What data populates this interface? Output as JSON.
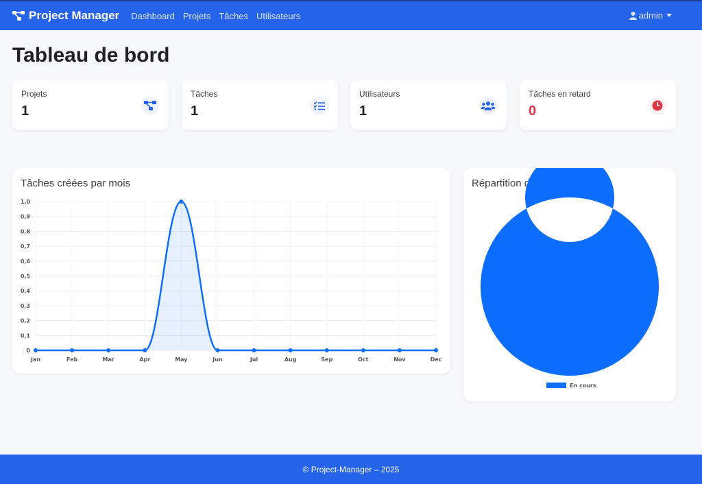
{
  "navbar": {
    "brand": "Project Manager",
    "links": [
      "Dashboard",
      "Projets",
      "Tâches",
      "Utilisateurs"
    ],
    "user": "admin"
  },
  "page": {
    "title": "Tableau de bord"
  },
  "stats": [
    {
      "label": "Projets",
      "value": "1",
      "icon": "project-diagram-icon"
    },
    {
      "label": "Tâches",
      "value": "1",
      "icon": "tasks-icon"
    },
    {
      "label": "Utilisateurs",
      "value": "1",
      "icon": "users-icon"
    },
    {
      "label": "Tâches en retard",
      "value": "0",
      "icon": "clock-icon"
    }
  ],
  "colors": {
    "primary": "#2563eb",
    "danger": "#dc3545",
    "chart_blue": "#0d6efd"
  },
  "chart_data": [
    {
      "type": "area",
      "title": "Tâches créées par mois",
      "categories": [
        "Jan",
        "Feb",
        "Mar",
        "Apr",
        "May",
        "Jun",
        "Jul",
        "Aug",
        "Sep",
        "Oct",
        "Nov",
        "Dec"
      ],
      "values": [
        0,
        0,
        0,
        0,
        1,
        0,
        0,
        0,
        0,
        0,
        0,
        0
      ],
      "ylim": [
        0,
        1
      ],
      "yticks": [
        "0",
        "0,1",
        "0,2",
        "0,3",
        "0,4",
        "0,5",
        "0,6",
        "0,7",
        "0,8",
        "0,9",
        "1,0"
      ],
      "grid": true
    },
    {
      "type": "pie",
      "title": "Répartition des statuts",
      "labels": [
        "En cours"
      ],
      "values": [
        1
      ],
      "legend": "bottom"
    }
  ],
  "footer": {
    "text": "© Project-Manager – 2025"
  }
}
